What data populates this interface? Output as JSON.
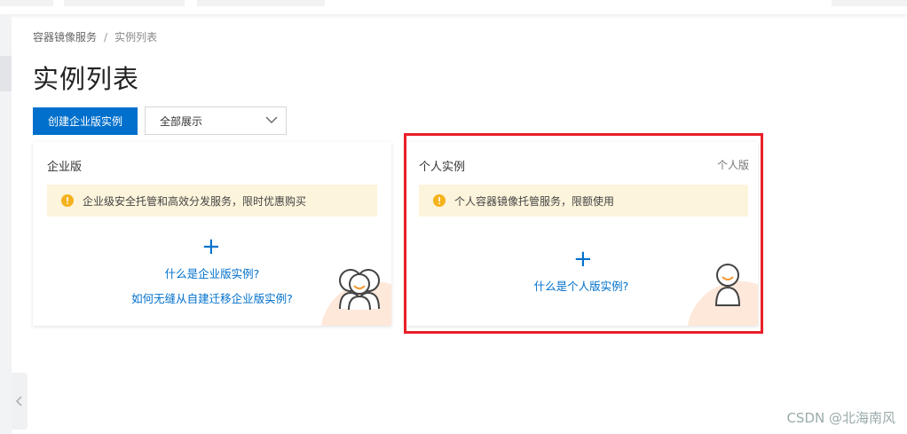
{
  "breadcrumb": {
    "parent": "容器镜像服务",
    "separator": "/",
    "current": "实例列表"
  },
  "page_title": "实例列表",
  "toolbar": {
    "create_label": "创建企业版实例",
    "filter_value": "全部展示"
  },
  "cards": {
    "enterprise": {
      "title": "企业版",
      "notice": "企业级安全托管和高效分发服务，限时优惠购买",
      "link1": "什么是企业版实例?",
      "link2": "如何无缝从自建迁移企业版实例?"
    },
    "personal": {
      "title": "个人实例",
      "tag": "个人版",
      "notice": "个人容器镜像托管服务，限额使用",
      "link1": "什么是个人版实例?"
    }
  },
  "plus_symbol": "+",
  "watermark": "CSDN @北海南风",
  "colors": {
    "primary": "#0070cc",
    "notice_bg": "#fdf4dc",
    "warning_icon": "#f5b21c",
    "highlight_border": "#e8202a",
    "avatar_smile": "#f39a34"
  },
  "icons": {
    "warning": "warning-icon",
    "dropdown": "chevron-down-icon",
    "add": "plus-icon",
    "enterprise_avatar": "people-group-icon",
    "personal_avatar": "person-icon",
    "collapse": "chevron-left-icon"
  }
}
